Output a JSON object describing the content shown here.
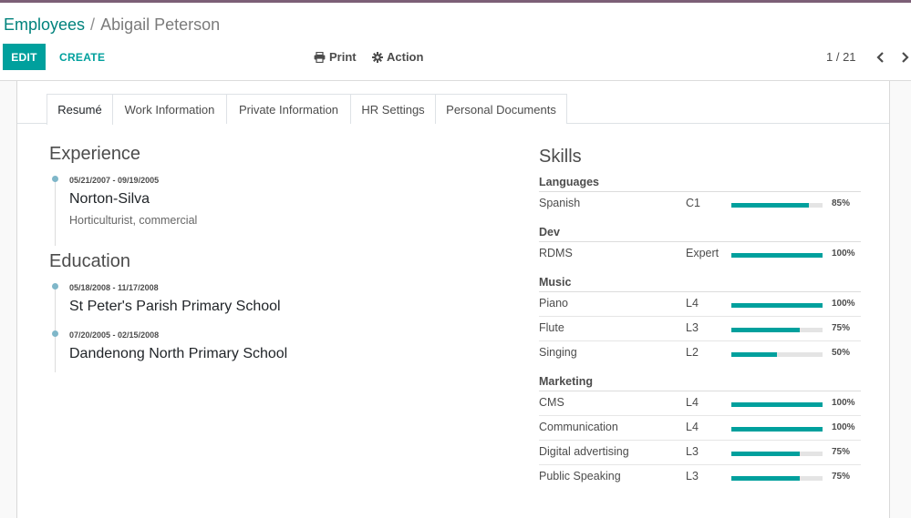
{
  "breadcrumb": {
    "parent": "Employees",
    "separator": "/",
    "current": "Abigail Peterson"
  },
  "toolbar": {
    "edit_label": "EDIT",
    "create_label": "CREATE",
    "print_label": "Print",
    "action_label": "Action"
  },
  "pager": {
    "value": "1 / 21"
  },
  "tabs": [
    {
      "label": "Resumé",
      "active": true
    },
    {
      "label": "Work Information"
    },
    {
      "label": "Private Information"
    },
    {
      "label": "HR Settings"
    },
    {
      "label": "Personal Documents"
    }
  ],
  "resume": {
    "experience": {
      "title": "Experience",
      "entries": [
        {
          "dates": "05/21/2007 - 09/19/2005",
          "name": "Norton-Silva",
          "description": "Horticulturist, commercial"
        }
      ]
    },
    "education": {
      "title": "Education",
      "entries": [
        {
          "dates": "05/18/2008 - 11/17/2008",
          "name": "St Peter's Parish Primary School"
        },
        {
          "dates": "07/20/2005 - 02/15/2008",
          "name": "Dandenong North Primary School"
        }
      ]
    }
  },
  "skills": {
    "title": "Skills",
    "groups": [
      {
        "name": "Languages",
        "items": [
          {
            "name": "Spanish",
            "level": "C1",
            "progress": "85%",
            "fraction": 0.85
          }
        ]
      },
      {
        "name": "Dev",
        "items": [
          {
            "name": "RDMS",
            "level": "Expert",
            "progress": "100%",
            "fraction": 1.0
          }
        ]
      },
      {
        "name": "Music",
        "items": [
          {
            "name": "Piano",
            "level": "L4",
            "progress": "100%",
            "fraction": 1.0
          },
          {
            "name": "Flute",
            "level": "L3",
            "progress": "75%",
            "fraction": 0.75
          },
          {
            "name": "Singing",
            "level": "L2",
            "progress": "50%",
            "fraction": 0.5
          }
        ]
      },
      {
        "name": "Marketing",
        "items": [
          {
            "name": "CMS",
            "level": "L4",
            "progress": "100%",
            "fraction": 1.0
          },
          {
            "name": "Communication",
            "level": "L4",
            "progress": "100%",
            "fraction": 1.0
          },
          {
            "name": "Digital advertising",
            "level": "L3",
            "progress": "75%",
            "fraction": 0.75
          },
          {
            "name": "Public Speaking",
            "level": "L3",
            "progress": "75%",
            "fraction": 0.75
          }
        ]
      }
    ]
  },
  "colors": {
    "accent": "#00a09d",
    "link": "#00827c",
    "top_bar": "#7c5f76",
    "timeline_dot": "#7fb7c9"
  },
  "icons": {
    "print": "print-icon",
    "action": "gear-icon",
    "prev": "chevron-left-icon",
    "next": "chevron-right-icon"
  }
}
